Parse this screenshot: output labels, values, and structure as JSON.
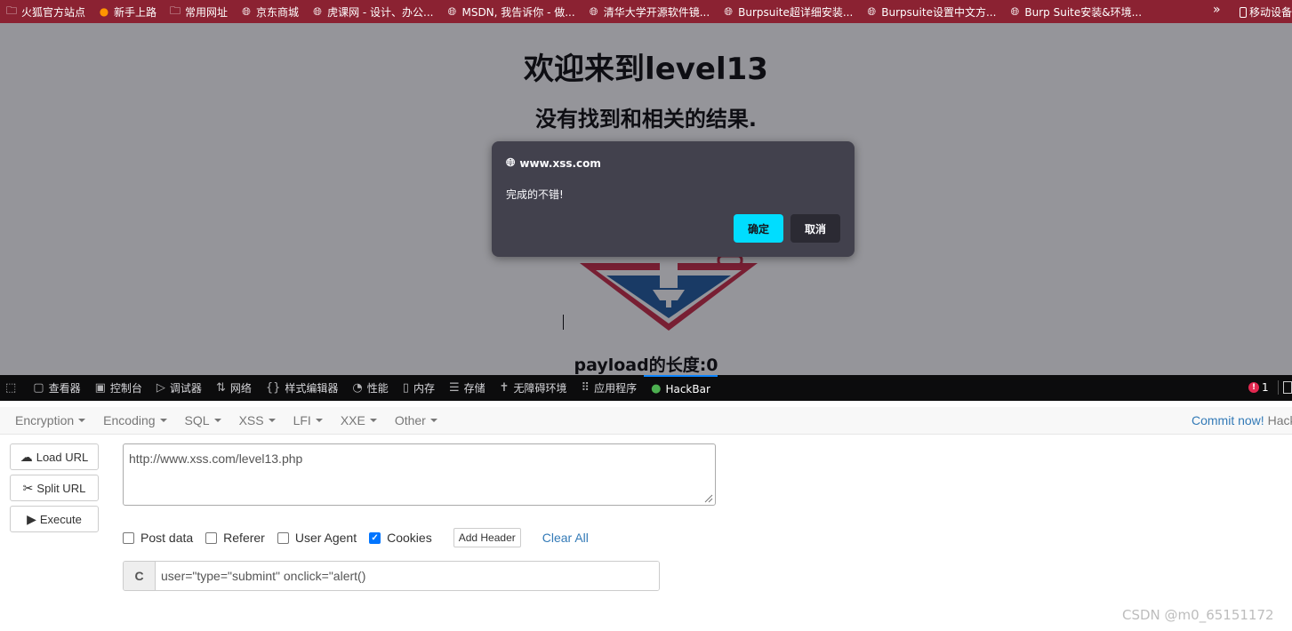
{
  "bookmarks": [
    {
      "label": "火狐官方站点",
      "icon": "folder-icon"
    },
    {
      "label": "新手上路",
      "icon": "firefox-icon"
    },
    {
      "label": "常用网址",
      "icon": "folder-icon"
    },
    {
      "label": "京东商城",
      "icon": "globe-icon"
    },
    {
      "label": "虎课网 - 设计、办公...",
      "icon": "globe-icon"
    },
    {
      "label": "MSDN, 我告诉你 - 做...",
      "icon": "globe-icon"
    },
    {
      "label": "清华大学开源软件镜...",
      "icon": "globe-icon"
    },
    {
      "label": "Burpsuite超详细安装...",
      "icon": "globe-icon"
    },
    {
      "label": "Burpsuite设置中文方...",
      "icon": "globe-icon"
    },
    {
      "label": "Burp Suite安装&环境...",
      "icon": "globe-icon"
    }
  ],
  "bookmarks_more": "»",
  "bookmarks_mobile": "移动设备",
  "page": {
    "title": "欢迎来到level13",
    "subtitle": "没有找到和相关的结果.",
    "payload_length": "payload的长度:0"
  },
  "dialog": {
    "origin": "www.xss.com",
    "message": "完成的不错!",
    "ok_label": "确定",
    "cancel_label": "取消"
  },
  "devtools": {
    "tabs": [
      {
        "label": "查看器",
        "icon": "inspector-icon"
      },
      {
        "label": "控制台",
        "icon": "console-icon"
      },
      {
        "label": "调试器",
        "icon": "debugger-icon"
      },
      {
        "label": "网络",
        "icon": "network-icon"
      },
      {
        "label": "样式编辑器",
        "icon": "style-editor-icon"
      },
      {
        "label": "性能",
        "icon": "performance-icon"
      },
      {
        "label": "内存",
        "icon": "memory-icon"
      },
      {
        "label": "存储",
        "icon": "storage-icon"
      },
      {
        "label": "无障碍环境",
        "icon": "accessibility-icon"
      },
      {
        "label": "应用程序",
        "icon": "application-icon"
      },
      {
        "label": "HackBar",
        "icon": "hackbar-icon"
      }
    ],
    "error_count": "1"
  },
  "hackbar": {
    "menu": [
      "Encryption",
      "Encoding",
      "SQL",
      "XSS",
      "LFI",
      "XXE",
      "Other"
    ],
    "commit_link": "Commit now!",
    "commit_suffix": "Hack",
    "load_url": "Load URL",
    "split_url": "Split URL",
    "execute": "Execute",
    "url_value": "http://www.xss.com/level13.php",
    "options": [
      {
        "label": "Post data",
        "checked": false
      },
      {
        "label": "Referer",
        "checked": false
      },
      {
        "label": "User Agent",
        "checked": false
      },
      {
        "label": "Cookies",
        "checked": true
      }
    ],
    "add_header": "Add Header",
    "clear_all": "Clear All",
    "cookie_prefix": "C",
    "cookie_value": "user=\"type=\"submint\" onclick=\"alert()"
  },
  "watermark": "CSDN @m0_65151172",
  "colors": {
    "bookmark_bar": "#8b2232",
    "dialog_bg": "#42414d",
    "ok_button": "#00ddff",
    "devtools_bg": "#0c0c0d",
    "link": "#337ab7"
  }
}
